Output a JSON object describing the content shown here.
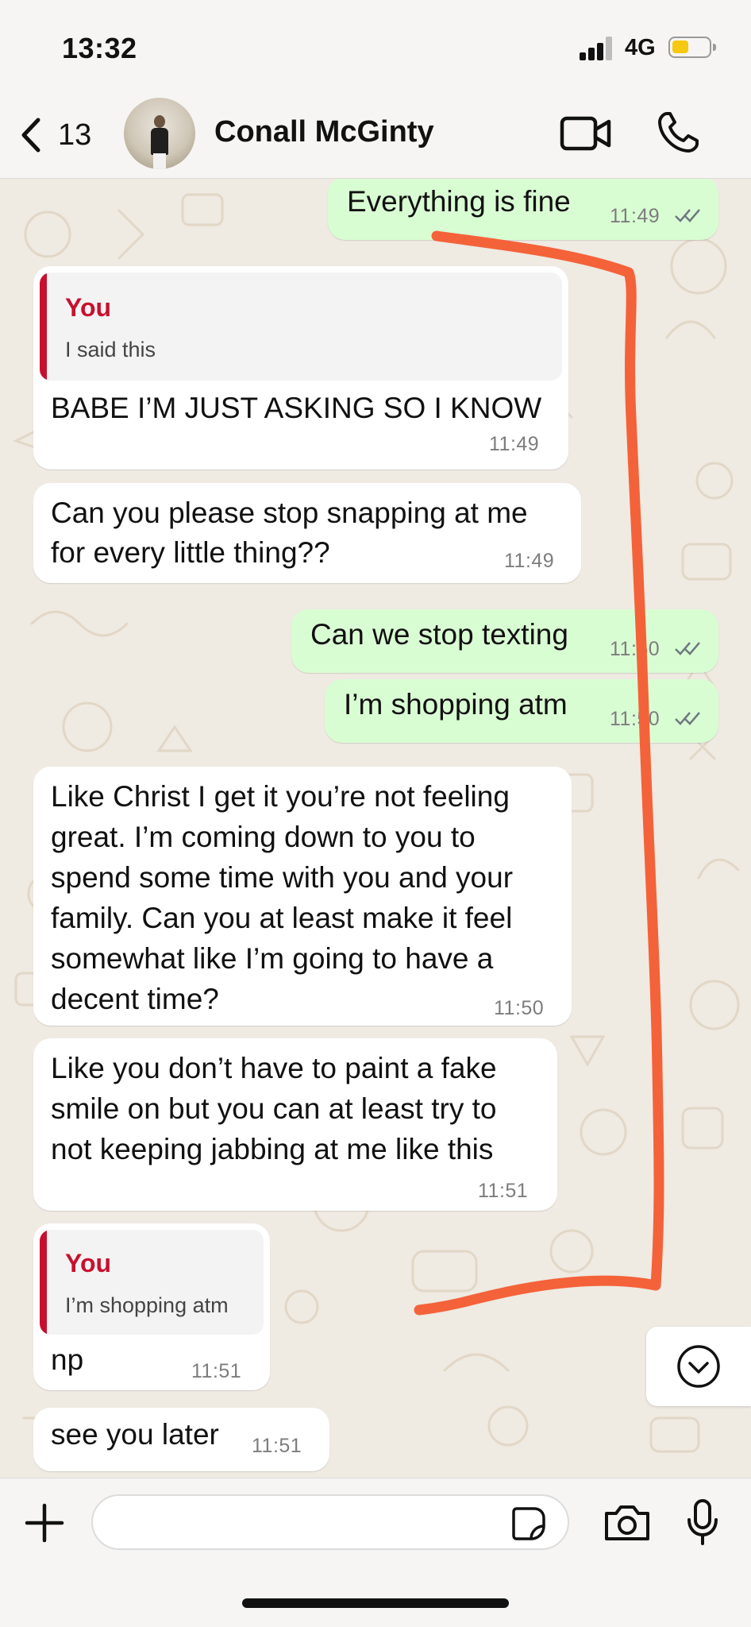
{
  "status_bar": {
    "time": "13:32",
    "network": "4G",
    "battery_level": 0.45,
    "signal_bars": 3
  },
  "header": {
    "back_count": "13",
    "contact_name": "Conall McGinty",
    "icons": [
      "back-chevron-icon",
      "video-call-icon",
      "voice-call-icon"
    ]
  },
  "messages": [
    {
      "direction": "out",
      "text": "Everything is fine",
      "time": "11:49",
      "status": "read"
    },
    {
      "direction": "in",
      "reply": {
        "author": "You",
        "text": "I said this"
      },
      "text": "BABE I’M JUST ASKING SO I KNOW",
      "time": "11:49"
    },
    {
      "direction": "in",
      "lines": [
        "Can you please stop snapping at me",
        "for every little thing??"
      ],
      "time": "11:49"
    },
    {
      "direction": "out",
      "text": "Can we stop texting",
      "time": "11:50",
      "status": "read"
    },
    {
      "direction": "out",
      "text": "I’m shopping atm",
      "time": "11:50",
      "status": "read"
    },
    {
      "direction": "in",
      "lines": [
        "Like Christ I get it you’re not feeling",
        "great. I’m coming down to you to",
        "spend some time with you and your",
        "family. Can you at least make it feel",
        "somewhat like I’m going to have a",
        "decent time?"
      ],
      "time": "11:50"
    },
    {
      "direction": "in",
      "lines": [
        "Like you don’t have to paint a fake",
        "smile on but you can at least try to",
        "not keeping jabbing at me like this"
      ],
      "time": "11:51"
    },
    {
      "direction": "in",
      "reply": {
        "author": "You",
        "text": "I’m shopping atm"
      },
      "text": "np",
      "time": "11:51"
    },
    {
      "direction": "in",
      "text": "see you later",
      "time": "11:51"
    }
  ],
  "colors": {
    "outgoing_bubble": "#d9fdd3",
    "incoming_bubble": "#ffffff",
    "reply_accent": "#c8102e",
    "annotation_stroke": "#f4623a",
    "read_ticks": "#6e7a80",
    "chat_background": "#efeae2"
  },
  "composer": {
    "placeholder": "",
    "icons": [
      "plus-icon",
      "sticker-icon",
      "camera-icon",
      "microphone-icon"
    ]
  },
  "scroll_button_icon": "chevron-down-circle-icon"
}
